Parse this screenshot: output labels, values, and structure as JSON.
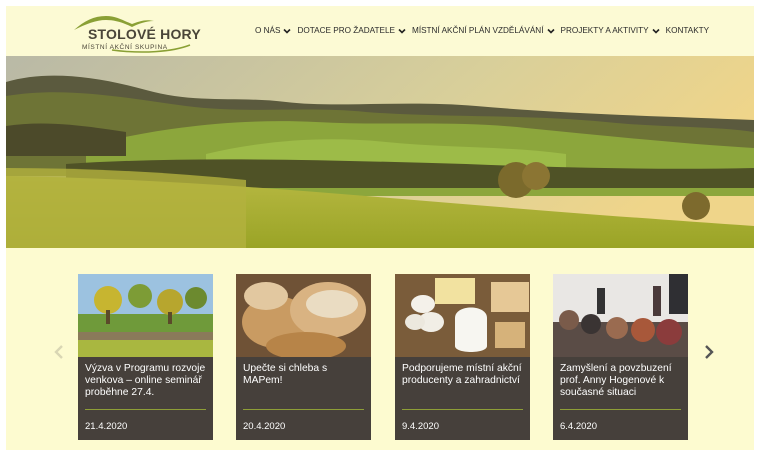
{
  "site": {
    "logo": {
      "name": "STOLOVÉ HORY",
      "subtitle": "MÍSTNÍ AKČNÍ SKUPINA"
    },
    "nav": [
      {
        "label": "O NÁS",
        "has_dropdown": true
      },
      {
        "label": "DOTACE PRO ŽADATELE",
        "has_dropdown": true
      },
      {
        "label": "MÍSTNÍ AKČNÍ PLÁN VZDĚLÁVÁNÍ",
        "has_dropdown": true
      },
      {
        "label": "PROJEKTY A AKTIVITY",
        "has_dropdown": true
      },
      {
        "label": "KONTAKTY",
        "has_dropdown": false
      }
    ]
  },
  "carousel": {
    "prev_icon": "chevron-left-icon",
    "next_icon": "chevron-right-icon",
    "cards": [
      {
        "title": "Výzva v Programu rozvoje venkova – online seminář proběhne 27.4.",
        "date": "21.4.2020",
        "image": "orchard-field-photo"
      },
      {
        "title": "Upečte si chleba s MAPem!",
        "date": "20.4.2020",
        "image": "bread-photo"
      },
      {
        "title": "Podporujeme místní akční producenty a zahradnictví",
        "date": "9.4.2020",
        "image": "dairy-products-photo"
      },
      {
        "title": "Zamyšlení a povzbuzení prof. Anny Hogenové k současné situaci",
        "date": "6.4.2020",
        "image": "lecture-audience-photo"
      }
    ]
  },
  "colors": {
    "background": "#fdfbd0",
    "card": "#46403b",
    "accent": "#8e9e37",
    "text_dark": "#2b2b2b"
  }
}
